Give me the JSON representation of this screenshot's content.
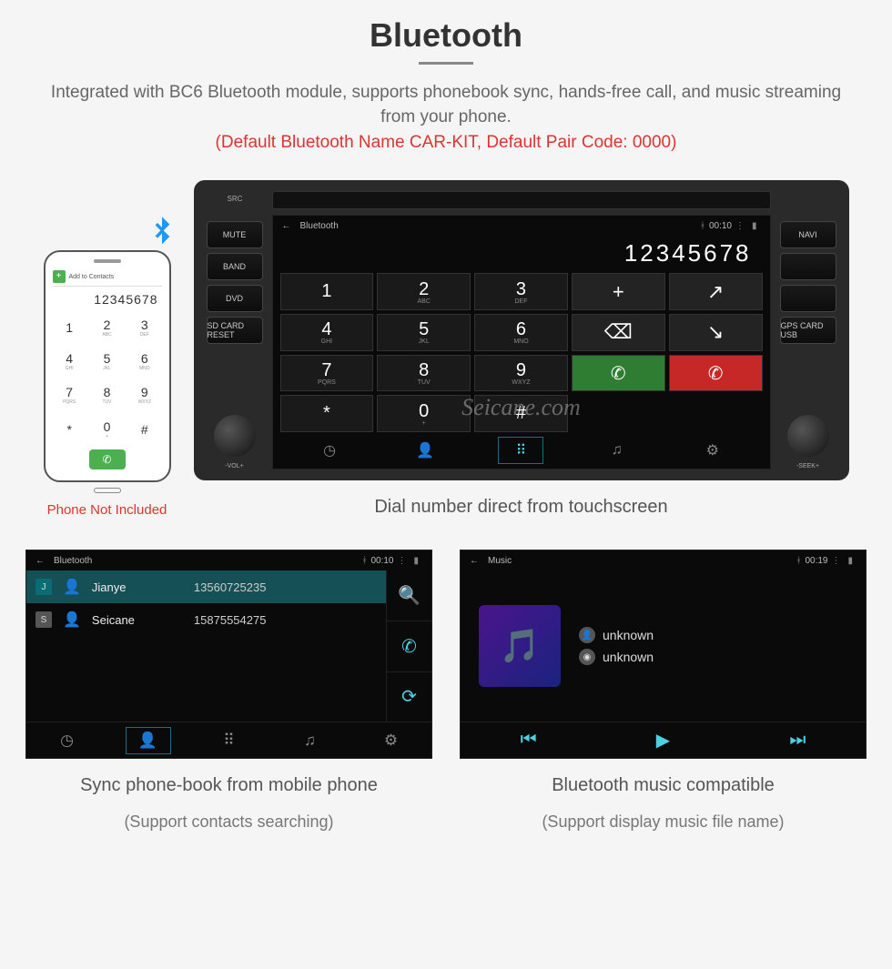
{
  "header": {
    "title": "Bluetooth",
    "subtitle": "Integrated with BC6 Bluetooth module, supports phonebook sync, hands-free call, and music streaming from your phone.",
    "warning": "(Default Bluetooth Name CAR-KIT, Default Pair Code: 0000)"
  },
  "phone": {
    "add_contacts": "Add to Contacts",
    "number": "12345678",
    "keys": [
      {
        "n": "1",
        "s": ""
      },
      {
        "n": "2",
        "s": "ABC"
      },
      {
        "n": "3",
        "s": "DEF"
      },
      {
        "n": "4",
        "s": "GHI"
      },
      {
        "n": "5",
        "s": "JKL"
      },
      {
        "n": "6",
        "s": "MNO"
      },
      {
        "n": "7",
        "s": "PQRS"
      },
      {
        "n": "8",
        "s": "TUV"
      },
      {
        "n": "9",
        "s": "WXYZ"
      },
      {
        "n": "*",
        "s": ""
      },
      {
        "n": "0",
        "s": "+"
      },
      {
        "n": "#",
        "s": ""
      }
    ],
    "caption": "Phone Not Included"
  },
  "unit": {
    "left_buttons": [
      "MUTE",
      "BAND",
      "DVD",
      "SD CARD RESET"
    ],
    "right_buttons": [
      "NAVI",
      "",
      "",
      "GPS CARD USB"
    ],
    "left_knob": "-VOL+",
    "right_knob": "-SEEK+",
    "src": "SRC",
    "status": {
      "back": "←",
      "title": "Bluetooth",
      "time": "00:10"
    },
    "display": "12345678",
    "keys": [
      {
        "n": "1",
        "s": "",
        "c": ""
      },
      {
        "n": "2",
        "s": "ABC",
        "c": ""
      },
      {
        "n": "3",
        "s": "DEF",
        "c": ""
      },
      {
        "n": "+",
        "s": "",
        "c": "action"
      },
      {
        "n": "↗",
        "s": "",
        "c": "action"
      },
      {
        "n": "4",
        "s": "GHI",
        "c": ""
      },
      {
        "n": "5",
        "s": "JKL",
        "c": ""
      },
      {
        "n": "6",
        "s": "MNO",
        "c": ""
      },
      {
        "n": "⌫",
        "s": "",
        "c": "action"
      },
      {
        "n": "↘",
        "s": "",
        "c": "action"
      },
      {
        "n": "7",
        "s": "PQRS",
        "c": ""
      },
      {
        "n": "8",
        "s": "TUV",
        "c": ""
      },
      {
        "n": "9",
        "s": "WXYZ",
        "c": ""
      },
      {
        "n": "✆",
        "s": "",
        "c": "green"
      },
      {
        "n": "✆",
        "s": "",
        "c": "red"
      },
      {
        "n": "*",
        "s": "",
        "c": ""
      },
      {
        "n": "0",
        "s": "+",
        "c": ""
      },
      {
        "n": "#",
        "s": "",
        "c": ""
      },
      {
        "n": "",
        "s": "",
        "c": "blank"
      },
      {
        "n": "",
        "s": "",
        "c": "blank"
      }
    ],
    "watermark": "Seicane.com",
    "caption": "Dial number direct from touchscreen"
  },
  "panel_contacts": {
    "status": {
      "title": "Bluetooth",
      "time": "00:10"
    },
    "rows": [
      {
        "letter": "J",
        "name": "Jianye",
        "number": "13560725235",
        "hl": true
      },
      {
        "letter": "S",
        "name": "Seicane",
        "number": "15875554275",
        "hl": false
      }
    ],
    "caption": "Sync phone-book from mobile phone",
    "caption_sub": "(Support contacts searching)"
  },
  "panel_music": {
    "status": {
      "title": "Music",
      "time": "00:19"
    },
    "artist": "unknown",
    "album": "unknown",
    "caption": "Bluetooth music compatible",
    "caption_sub": "(Support display music file name)"
  }
}
